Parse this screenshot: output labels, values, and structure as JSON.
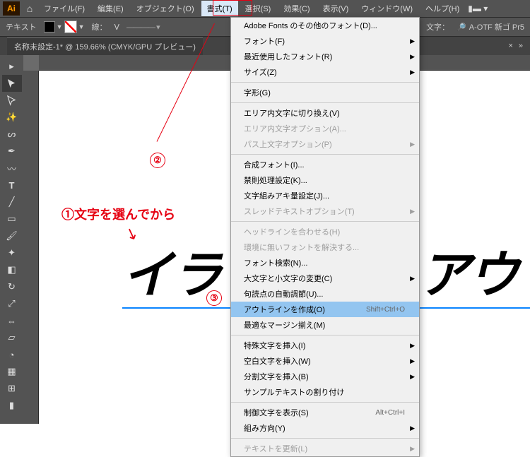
{
  "menubar": {
    "items": [
      "ファイル(F)",
      "編集(E)",
      "オブジェクト(O)",
      "書式(T)",
      "選択(S)",
      "効果(C)",
      "表示(V)",
      "ウィンドウ(W)",
      "ヘルプ(H)"
    ],
    "active": 3
  },
  "controlbar": {
    "mode": "テキスト",
    "stroke_label": "線：",
    "char_label": "文字：",
    "font": "A-OTF 新ゴ Pr5"
  },
  "tab": {
    "title": "名称未設定-1* @ 159.66% (CMYK/GPU プレビュー)"
  },
  "canvas": {
    "big_text_left": "イラ",
    "big_text_right": "アウト"
  },
  "annotations": {
    "step1": "①文字を選んでから",
    "step2": "②",
    "step3": "③"
  },
  "menu": {
    "groups": [
      [
        {
          "label": "Adobe Fonts のその他のフォント(D)...",
          "enabled": true
        },
        {
          "label": "フォント(F)",
          "enabled": true,
          "sub": true
        },
        {
          "label": "最近使用したフォント(R)",
          "enabled": true,
          "sub": true
        },
        {
          "label": "サイズ(Z)",
          "enabled": true,
          "sub": true
        }
      ],
      [
        {
          "label": "字形(G)",
          "enabled": true
        }
      ],
      [
        {
          "label": "エリア内文字に切り換え(V)",
          "enabled": true
        },
        {
          "label": "エリア内文字オプション(A)...",
          "enabled": false
        },
        {
          "label": "パス上文字オプション(P)",
          "enabled": false,
          "sub": true
        }
      ],
      [
        {
          "label": "合成フォント(I)...",
          "enabled": true
        },
        {
          "label": "禁則処理設定(K)...",
          "enabled": true
        },
        {
          "label": "文字組みアキ量設定(J)...",
          "enabled": true
        },
        {
          "label": "スレッドテキストオプション(T)",
          "enabled": false,
          "sub": true
        }
      ],
      [
        {
          "label": "ヘッドラインを合わせる(H)",
          "enabled": false
        },
        {
          "label": "環境に無いフォントを解決する...",
          "enabled": false
        },
        {
          "label": "フォント検索(N)...",
          "enabled": true
        },
        {
          "label": "大文字と小文字の変更(C)",
          "enabled": true,
          "sub": true
        },
        {
          "label": "句読点の自動調節(U)...",
          "enabled": true
        },
        {
          "label": "アウトラインを作成(O)",
          "enabled": true,
          "shortcut": "Shift+Ctrl+O",
          "hl": true
        },
        {
          "label": "最適なマージン揃え(M)",
          "enabled": true
        }
      ],
      [
        {
          "label": "特殊文字を挿入(I)",
          "enabled": true,
          "sub": true
        },
        {
          "label": "空白文字を挿入(W)",
          "enabled": true,
          "sub": true
        },
        {
          "label": "分割文字を挿入(B)",
          "enabled": true,
          "sub": true
        },
        {
          "label": "サンプルテキストの割り付け",
          "enabled": true
        }
      ],
      [
        {
          "label": "制御文字を表示(S)",
          "enabled": true,
          "shortcut": "Alt+Ctrl+I"
        },
        {
          "label": "組み方向(Y)",
          "enabled": true,
          "sub": true
        }
      ],
      [
        {
          "label": "テキストを更新(L)",
          "enabled": false,
          "sub": true
        }
      ]
    ]
  }
}
